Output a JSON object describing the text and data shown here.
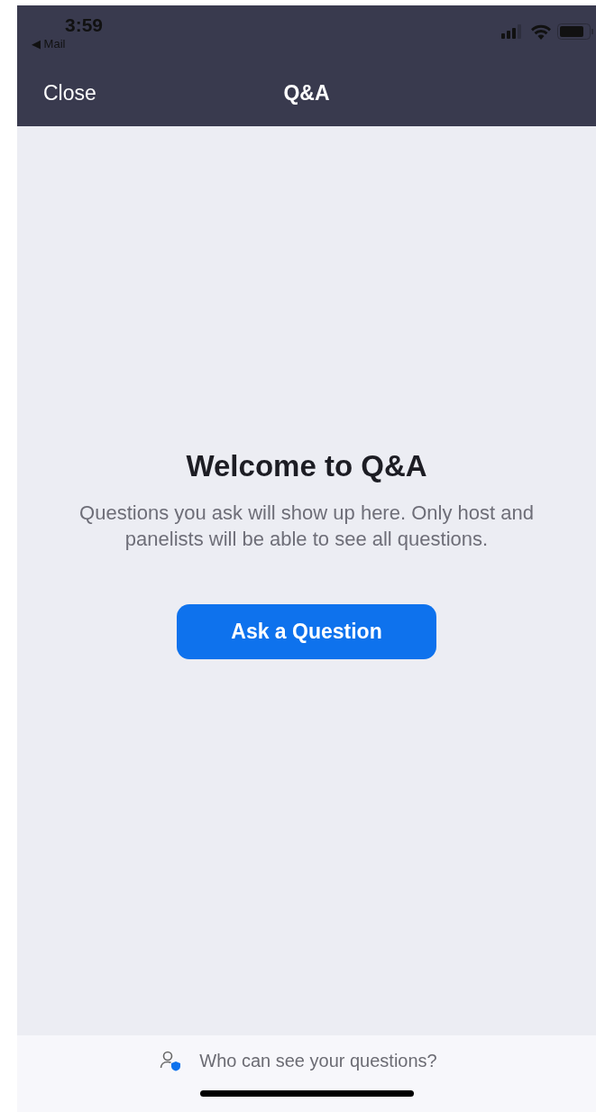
{
  "status_bar": {
    "time": "3:59",
    "back_app": "◀ Mail"
  },
  "nav_bar": {
    "left_button": "Close",
    "title": "Q&A"
  },
  "empty_state": {
    "title": "Welcome to Q&A",
    "message": "Questions you ask will show up here. Only host and panelists will be able to see all questions.",
    "button": "Ask a Question"
  },
  "footer": {
    "link": "Who can see your questions?"
  }
}
